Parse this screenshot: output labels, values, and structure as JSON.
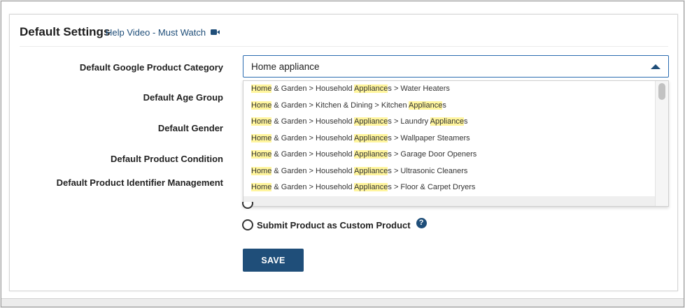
{
  "header": {
    "title": "Default Settings",
    "help_link": "Help Video - Must Watch",
    "help_icon": "video-camera-icon"
  },
  "form": {
    "labels": {
      "google_category": "Default Google Product Category",
      "age_group": "Default Age Group",
      "gender": "Default Gender",
      "condition": "Default Product Condition",
      "identifier": "Default Product Identifier Management"
    },
    "category_select": {
      "value": "Home appliance"
    },
    "dropdown_options": [
      [
        [
          "Home",
          true
        ],
        [
          " & Garden > Household ",
          false
        ],
        [
          "Appliance",
          true
        ],
        [
          "s > Water Heaters",
          false
        ]
      ],
      [
        [
          "Home",
          true
        ],
        [
          " & Garden > Kitchen & Dining > Kitchen ",
          false
        ],
        [
          "Appliance",
          true
        ],
        [
          "s",
          false
        ]
      ],
      [
        [
          "Home",
          true
        ],
        [
          " & Garden > Household ",
          false
        ],
        [
          "Appliance",
          true
        ],
        [
          "s > Laundry ",
          false
        ],
        [
          "Appliance",
          true
        ],
        [
          "s",
          false
        ]
      ],
      [
        [
          "Home",
          true
        ],
        [
          " & Garden > Household ",
          false
        ],
        [
          "Appliance",
          true
        ],
        [
          "s > Wallpaper Steamers",
          false
        ]
      ],
      [
        [
          "Home",
          true
        ],
        [
          " & Garden > Household ",
          false
        ],
        [
          "Appliance",
          true
        ],
        [
          "s > Garage Door Openers",
          false
        ]
      ],
      [
        [
          "Home",
          true
        ],
        [
          " & Garden > Household ",
          false
        ],
        [
          "Appliance",
          true
        ],
        [
          "s > Ultrasonic Cleaners",
          false
        ]
      ],
      [
        [
          "Home",
          true
        ],
        [
          " & Garden > Household ",
          false
        ],
        [
          "Appliance",
          true
        ],
        [
          "s > Floor & Carpet Dryers",
          false
        ]
      ]
    ],
    "custom_product_radio": {
      "label": "Submit Product as Custom Product",
      "help": "?"
    },
    "save_label": "SAVE"
  },
  "colors": {
    "accent": "#1f4e79",
    "highlight": "#fff59d"
  }
}
